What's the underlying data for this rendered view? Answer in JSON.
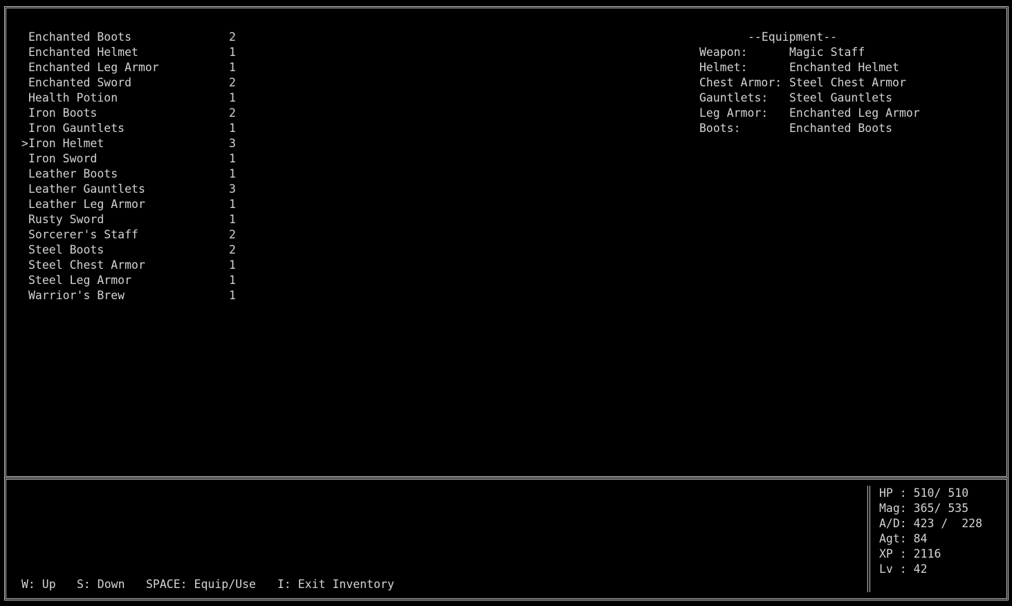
{
  "inventory": {
    "items": [
      {
        "name": "Enchanted Boots",
        "qty": "2"
      },
      {
        "name": "Enchanted Helmet",
        "qty": "1"
      },
      {
        "name": "Enchanted Leg Armor",
        "qty": "1"
      },
      {
        "name": "Enchanted Sword",
        "qty": "2"
      },
      {
        "name": "Health Potion",
        "qty": "1"
      },
      {
        "name": "Iron Boots",
        "qty": "2"
      },
      {
        "name": "Iron Gauntlets",
        "qty": "1"
      },
      {
        "name": "Iron Helmet",
        "qty": "3"
      },
      {
        "name": "Iron Sword",
        "qty": "1"
      },
      {
        "name": "Leather Boots",
        "qty": "1"
      },
      {
        "name": "Leather Gauntlets",
        "qty": "3"
      },
      {
        "name": "Leather Leg Armor",
        "qty": "1"
      },
      {
        "name": "Rusty Sword",
        "qty": "1"
      },
      {
        "name": "Sorcerer's Staff",
        "qty": "2"
      },
      {
        "name": "Steel Boots",
        "qty": "2"
      },
      {
        "name": "Steel Chest Armor",
        "qty": "1"
      },
      {
        "name": "Steel Leg Armor",
        "qty": "1"
      },
      {
        "name": "Warrior's Brew",
        "qty": "1"
      }
    ],
    "cursor": ">",
    "selected_item": "Iron Helmet"
  },
  "equipment": {
    "title": "--Equipment--",
    "slots": [
      {
        "label": "Weapon:",
        "value": "Magic Staff"
      },
      {
        "label": "Helmet:",
        "value": "Enchanted Helmet"
      },
      {
        "label": "Chest Armor:",
        "value": "Steel Chest Armor"
      },
      {
        "label": "Gauntlets:",
        "value": "Steel Gauntlets"
      },
      {
        "label": "Leg Armor:",
        "value": "Enchanted Leg Armor"
      },
      {
        "label": "Boots:",
        "value": "Enchanted Boots"
      }
    ]
  },
  "controls": {
    "up": "W: Up",
    "down": "S: Down",
    "equip": "SPACE: Equip/Use",
    "exit": "I: Exit Inventory"
  },
  "stats": {
    "hp": "HP : 510/ 510",
    "mag": "Mag: 365/ 535",
    "ad": "A/D: 423 /  228",
    "agt": "Agt: 84",
    "xp": "XP : 2116",
    "lv": "Lv : 42"
  },
  "colors": {
    "background": "#000000",
    "text": "#d4d4d4",
    "border": "#c8c8c8"
  }
}
